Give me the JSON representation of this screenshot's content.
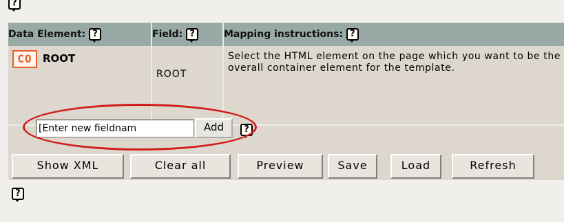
{
  "help_icon_glyph": "?",
  "table": {
    "headers": {
      "data_element": "Data Element:",
      "field": "Field:",
      "mapping": "Mapping instructions:"
    },
    "row": {
      "badge": "CO",
      "element": "ROOT",
      "field": "ROOT",
      "instructions": "Select the HTML element on the page which you want to be the overall container element for the template."
    }
  },
  "new_field": {
    "value": "[Enter new fieldnam",
    "add_label": "Add"
  },
  "buttons": {
    "show_xml": "Show XML",
    "clear_all": "Clear all",
    "preview": "Preview",
    "save": "Save",
    "load": "Load",
    "refresh": "Refresh"
  },
  "colors": {
    "header_bg": "#99aaa6",
    "row_bg": "#ddd7cd",
    "badge": "#e4612c",
    "highlight": "#d11d1d"
  }
}
